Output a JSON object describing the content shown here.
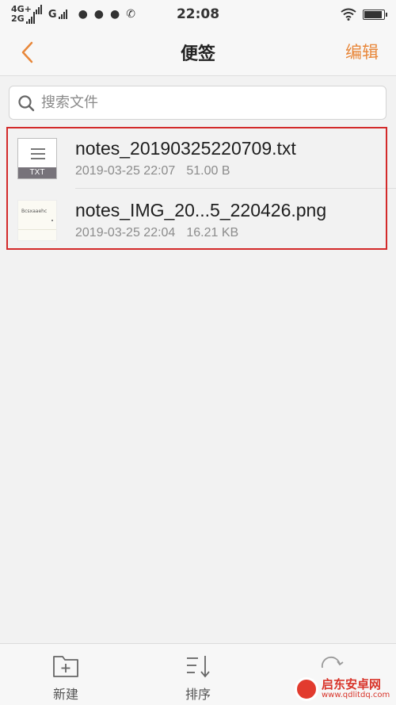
{
  "status_bar": {
    "net_top": "4G+",
    "net_bottom": "2G",
    "g_label": "G",
    "time": "22:08",
    "battery_level": 0.9
  },
  "header": {
    "title": "便签",
    "edit_label": "编辑",
    "accent_color": "#e8873a"
  },
  "search": {
    "placeholder": "搜索文件"
  },
  "files": [
    {
      "name": "notes_20190325220709.txt",
      "date": "2019-03-25 22:07",
      "size": "51.00 B",
      "thumb_label": "TXT"
    },
    {
      "name": "notes_IMG_20...5_220426.png",
      "date": "2019-03-25 22:04",
      "size": "16.21 KB",
      "thumb_text": "Bcsxaaehc"
    }
  ],
  "bottom_bar": {
    "new_label": "新建",
    "sort_label": "排序"
  },
  "watermark": {
    "name": "启东安卓网",
    "url": "www.qdlitdq.com"
  }
}
